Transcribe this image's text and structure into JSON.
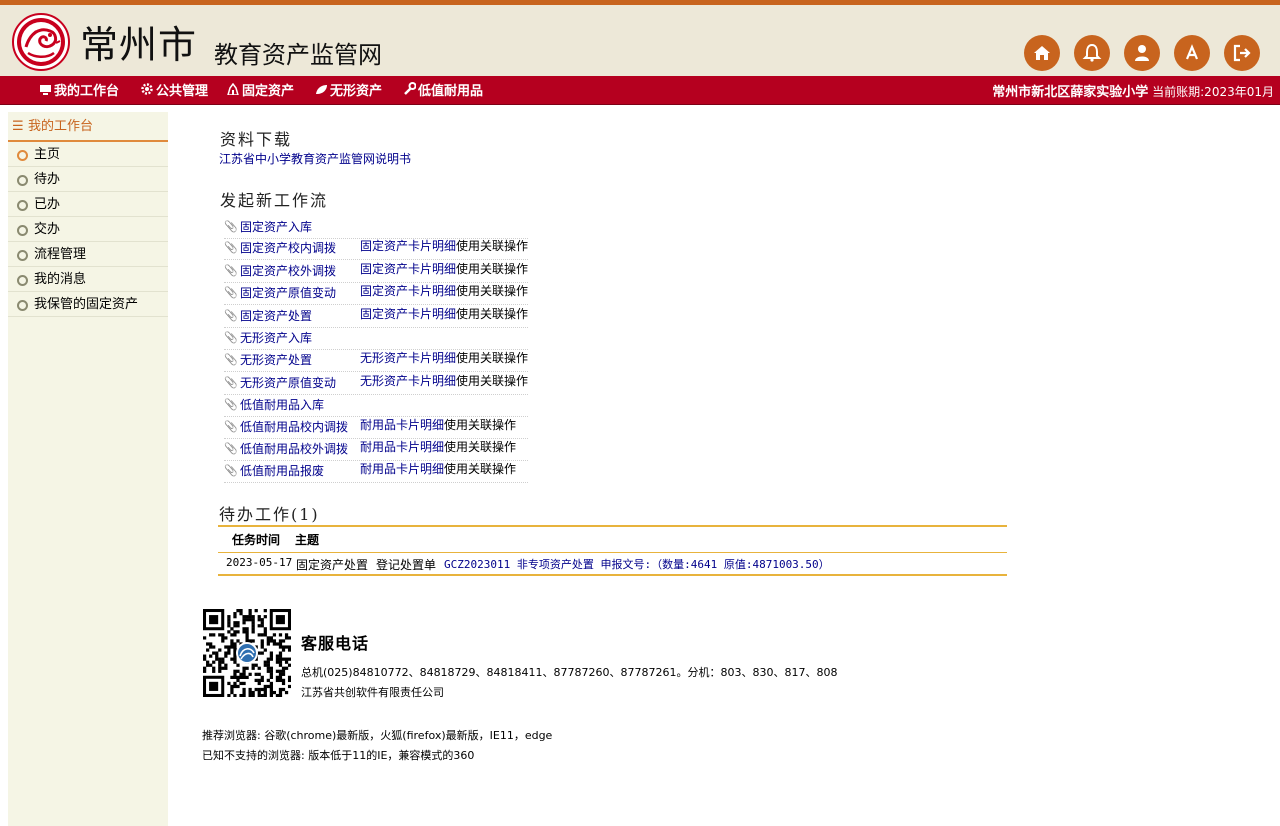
{
  "header": {
    "city": "常州市",
    "site_name": "教育资产监管网",
    "icons": [
      "home-icon",
      "bell-icon",
      "user-icon",
      "font-icon",
      "logout-icon"
    ],
    "accent_color": "#c8641e"
  },
  "nav": {
    "items": [
      {
        "label": "我的工作台",
        "icon": "monitor-icon"
      },
      {
        "label": "公共管理",
        "icon": "gear-icon"
      },
      {
        "label": "固定资产",
        "icon": "building-icon"
      },
      {
        "label": "无形资产",
        "icon": "leaf-icon"
      },
      {
        "label": "低值耐用品",
        "icon": "wrench-icon"
      }
    ],
    "school": "常州市新北区薛家实验小学",
    "period_label": "当前账期:2023年01月",
    "bar_color": "#b5001f"
  },
  "sidebar": {
    "title": "我的工作台",
    "items": [
      {
        "label": "主页"
      },
      {
        "label": "待办"
      },
      {
        "label": "已办"
      },
      {
        "label": "交办"
      },
      {
        "label": "流程管理"
      },
      {
        "label": "我的消息"
      },
      {
        "label": "我保管的固定资产"
      }
    ]
  },
  "downloads": {
    "title": "资料下载",
    "link": "江苏省中小学教育资产监管网说明书"
  },
  "workflow": {
    "title": "发起新工作流",
    "suffix": "使用关联操作",
    "rows": [
      {
        "name": "固定资产入库",
        "card": ""
      },
      {
        "name": "固定资产校内调拨",
        "card": "固定资产卡片明细"
      },
      {
        "name": "固定资产校外调拨",
        "card": "固定资产卡片明细"
      },
      {
        "name": "固定资产原值变动",
        "card": "固定资产卡片明细"
      },
      {
        "name": "固定资产处置",
        "card": "固定资产卡片明细"
      },
      {
        "name": "无形资产入库",
        "card": ""
      },
      {
        "name": "无形资产处置",
        "card": "无形资产卡片明细"
      },
      {
        "name": "无形资产原值变动",
        "card": "无形资产卡片明细"
      },
      {
        "name": "低值耐用品入库",
        "card": ""
      },
      {
        "name": "低值耐用品校内调拨",
        "card": "耐用品卡片明细"
      },
      {
        "name": "低值耐用品校外调拨",
        "card": "耐用品卡片明细"
      },
      {
        "name": "低值耐用品报废",
        "card": "耐用品卡片明细"
      }
    ]
  },
  "todo": {
    "title": "待办工作(1)",
    "headers": {
      "time": "任务时间",
      "subject": "主题"
    },
    "rows": [
      {
        "date": "2023-05-17",
        "type": "固定资产处置",
        "step": "登记处置单",
        "detail": "GCZ2023011 非专项资产处置 申报文号:（数量:4641 原值:4871003.50）"
      }
    ]
  },
  "service": {
    "title": "客服电话",
    "phones": "总机(025)84810772、84818729、84818411、87787260、87787261。分机：803、830、817、808",
    "company": "江苏省共创软件有限责任公司"
  },
  "browsers": {
    "recommended": "推荐浏览器: 谷歌(chrome)最新版，火狐(firefox)最新版，IE11，edge",
    "unsupported": "已知不支持的浏览器: 版本低于11的IE，兼容模式的360"
  }
}
